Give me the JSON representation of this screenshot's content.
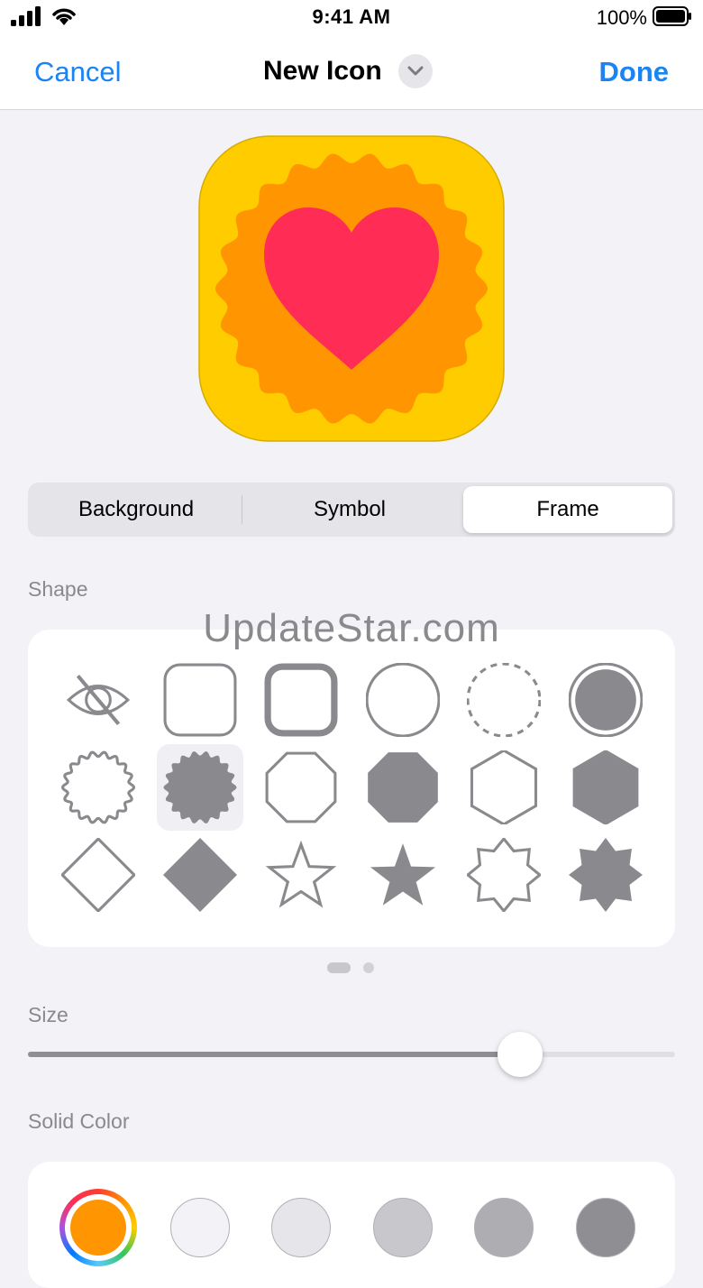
{
  "status_bar": {
    "time": "9:41 AM",
    "battery": "100%"
  },
  "nav": {
    "cancel": "Cancel",
    "title": "New Icon",
    "done": "Done"
  },
  "colors": {
    "accent": "#1a84f4",
    "icon_bg": "#ffcc00",
    "frame": "#ff9500",
    "heart": "#ff2d55",
    "shape_gray": "#8a8a8e"
  },
  "tabs": [
    {
      "label": "Background",
      "selected": false
    },
    {
      "label": "Symbol",
      "selected": false
    },
    {
      "label": "Frame",
      "selected": true
    }
  ],
  "shape_section": {
    "label": "Shape",
    "shapes": [
      "hidden-eye-icon",
      "rounded-square-outline-icon",
      "rounded-square-thick-outline-icon",
      "circle-outline-icon",
      "dashed-circle-icon",
      "filled-ring-circle-icon",
      "scalloped-circle-outline-icon",
      "scalloped-circle-filled-icon",
      "octagon-outline-icon",
      "octagon-filled-icon",
      "hexagon-outline-icon",
      "hexagon-filled-icon",
      "diamond-outline-icon",
      "diamond-filled-icon",
      "star-outline-icon",
      "star-filled-icon",
      "eight-point-star-outline-icon",
      "eight-point-star-filled-icon"
    ],
    "selected_index": 7,
    "page": 1,
    "pages": 2
  },
  "watermark": "UpdateStar.com",
  "size_section": {
    "label": "Size",
    "value": 0.76
  },
  "color_section": {
    "label": "Solid Color",
    "swatches": [
      "#ff9500",
      "#f2f2f7",
      "#e5e5ea",
      "#c7c7cc",
      "#aeaeb2",
      "#8e8e93"
    ],
    "selected_index": 0
  }
}
